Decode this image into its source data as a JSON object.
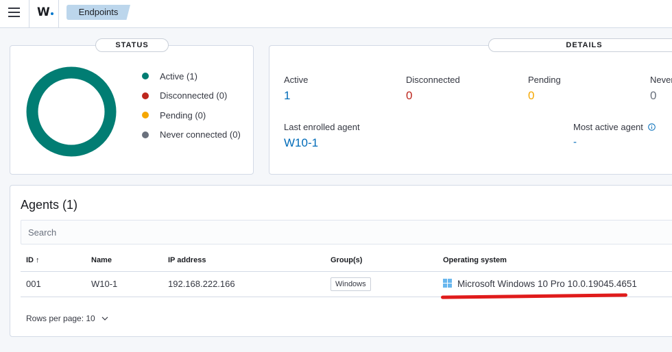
{
  "header": {
    "logo": "W",
    "breadcrumb": "Endpoints"
  },
  "status": {
    "title": "STATUS",
    "legend": [
      {
        "label": "Active (1)",
        "color": "#017d73"
      },
      {
        "label": "Disconnected (0)",
        "color": "#bd271e"
      },
      {
        "label": "Pending (0)",
        "color": "#f5a700"
      },
      {
        "label": "Never connected (0)",
        "color": "#6a717d"
      }
    ],
    "donut_color": "#017d73"
  },
  "details": {
    "title": "DETAILS",
    "active_label": "Active",
    "active_value": "1",
    "disconnected_label": "Disconnected",
    "disconnected_value": "0",
    "pending_label": "Pending",
    "pending_value": "0",
    "never_label": "Never",
    "never_value": "0",
    "last_enrolled_label": "Last enrolled agent",
    "last_enrolled_value": "W10-1",
    "most_active_label": "Most active agent",
    "most_active_value": "-"
  },
  "agents": {
    "title": "Agents (1)",
    "search_placeholder": "Search",
    "columns": [
      "ID ↑",
      "Name",
      "IP address",
      "Group(s)",
      "Operating system"
    ],
    "rows": [
      {
        "id": "001",
        "name": "W10-1",
        "ip": "192.168.222.166",
        "group": "Windows",
        "os": "Microsoft Windows 10 Pro 10.0.19045.4651"
      }
    ],
    "rows_per_page": "Rows per page: 10"
  }
}
